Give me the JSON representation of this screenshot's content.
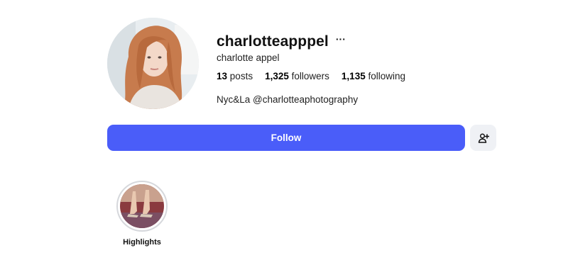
{
  "profile": {
    "username": "charlotteapppel",
    "more_label": "···",
    "full_name": "charlotte appel",
    "bio": "Nyc&La @charlotteaphotography"
  },
  "stats": {
    "posts_count": "13",
    "posts_label": "posts",
    "followers_count": "1,325",
    "followers_label": "followers",
    "following_count": "1,135",
    "following_label": "following"
  },
  "actions": {
    "follow_label": "Follow",
    "add_user_icon": "person-add-icon"
  },
  "highlights": [
    {
      "label": "Highlights"
    }
  ],
  "colors": {
    "accent": "#4a5df9",
    "secondary_button": "#eff1f5",
    "highlight_ring": "#d6d8dc"
  }
}
